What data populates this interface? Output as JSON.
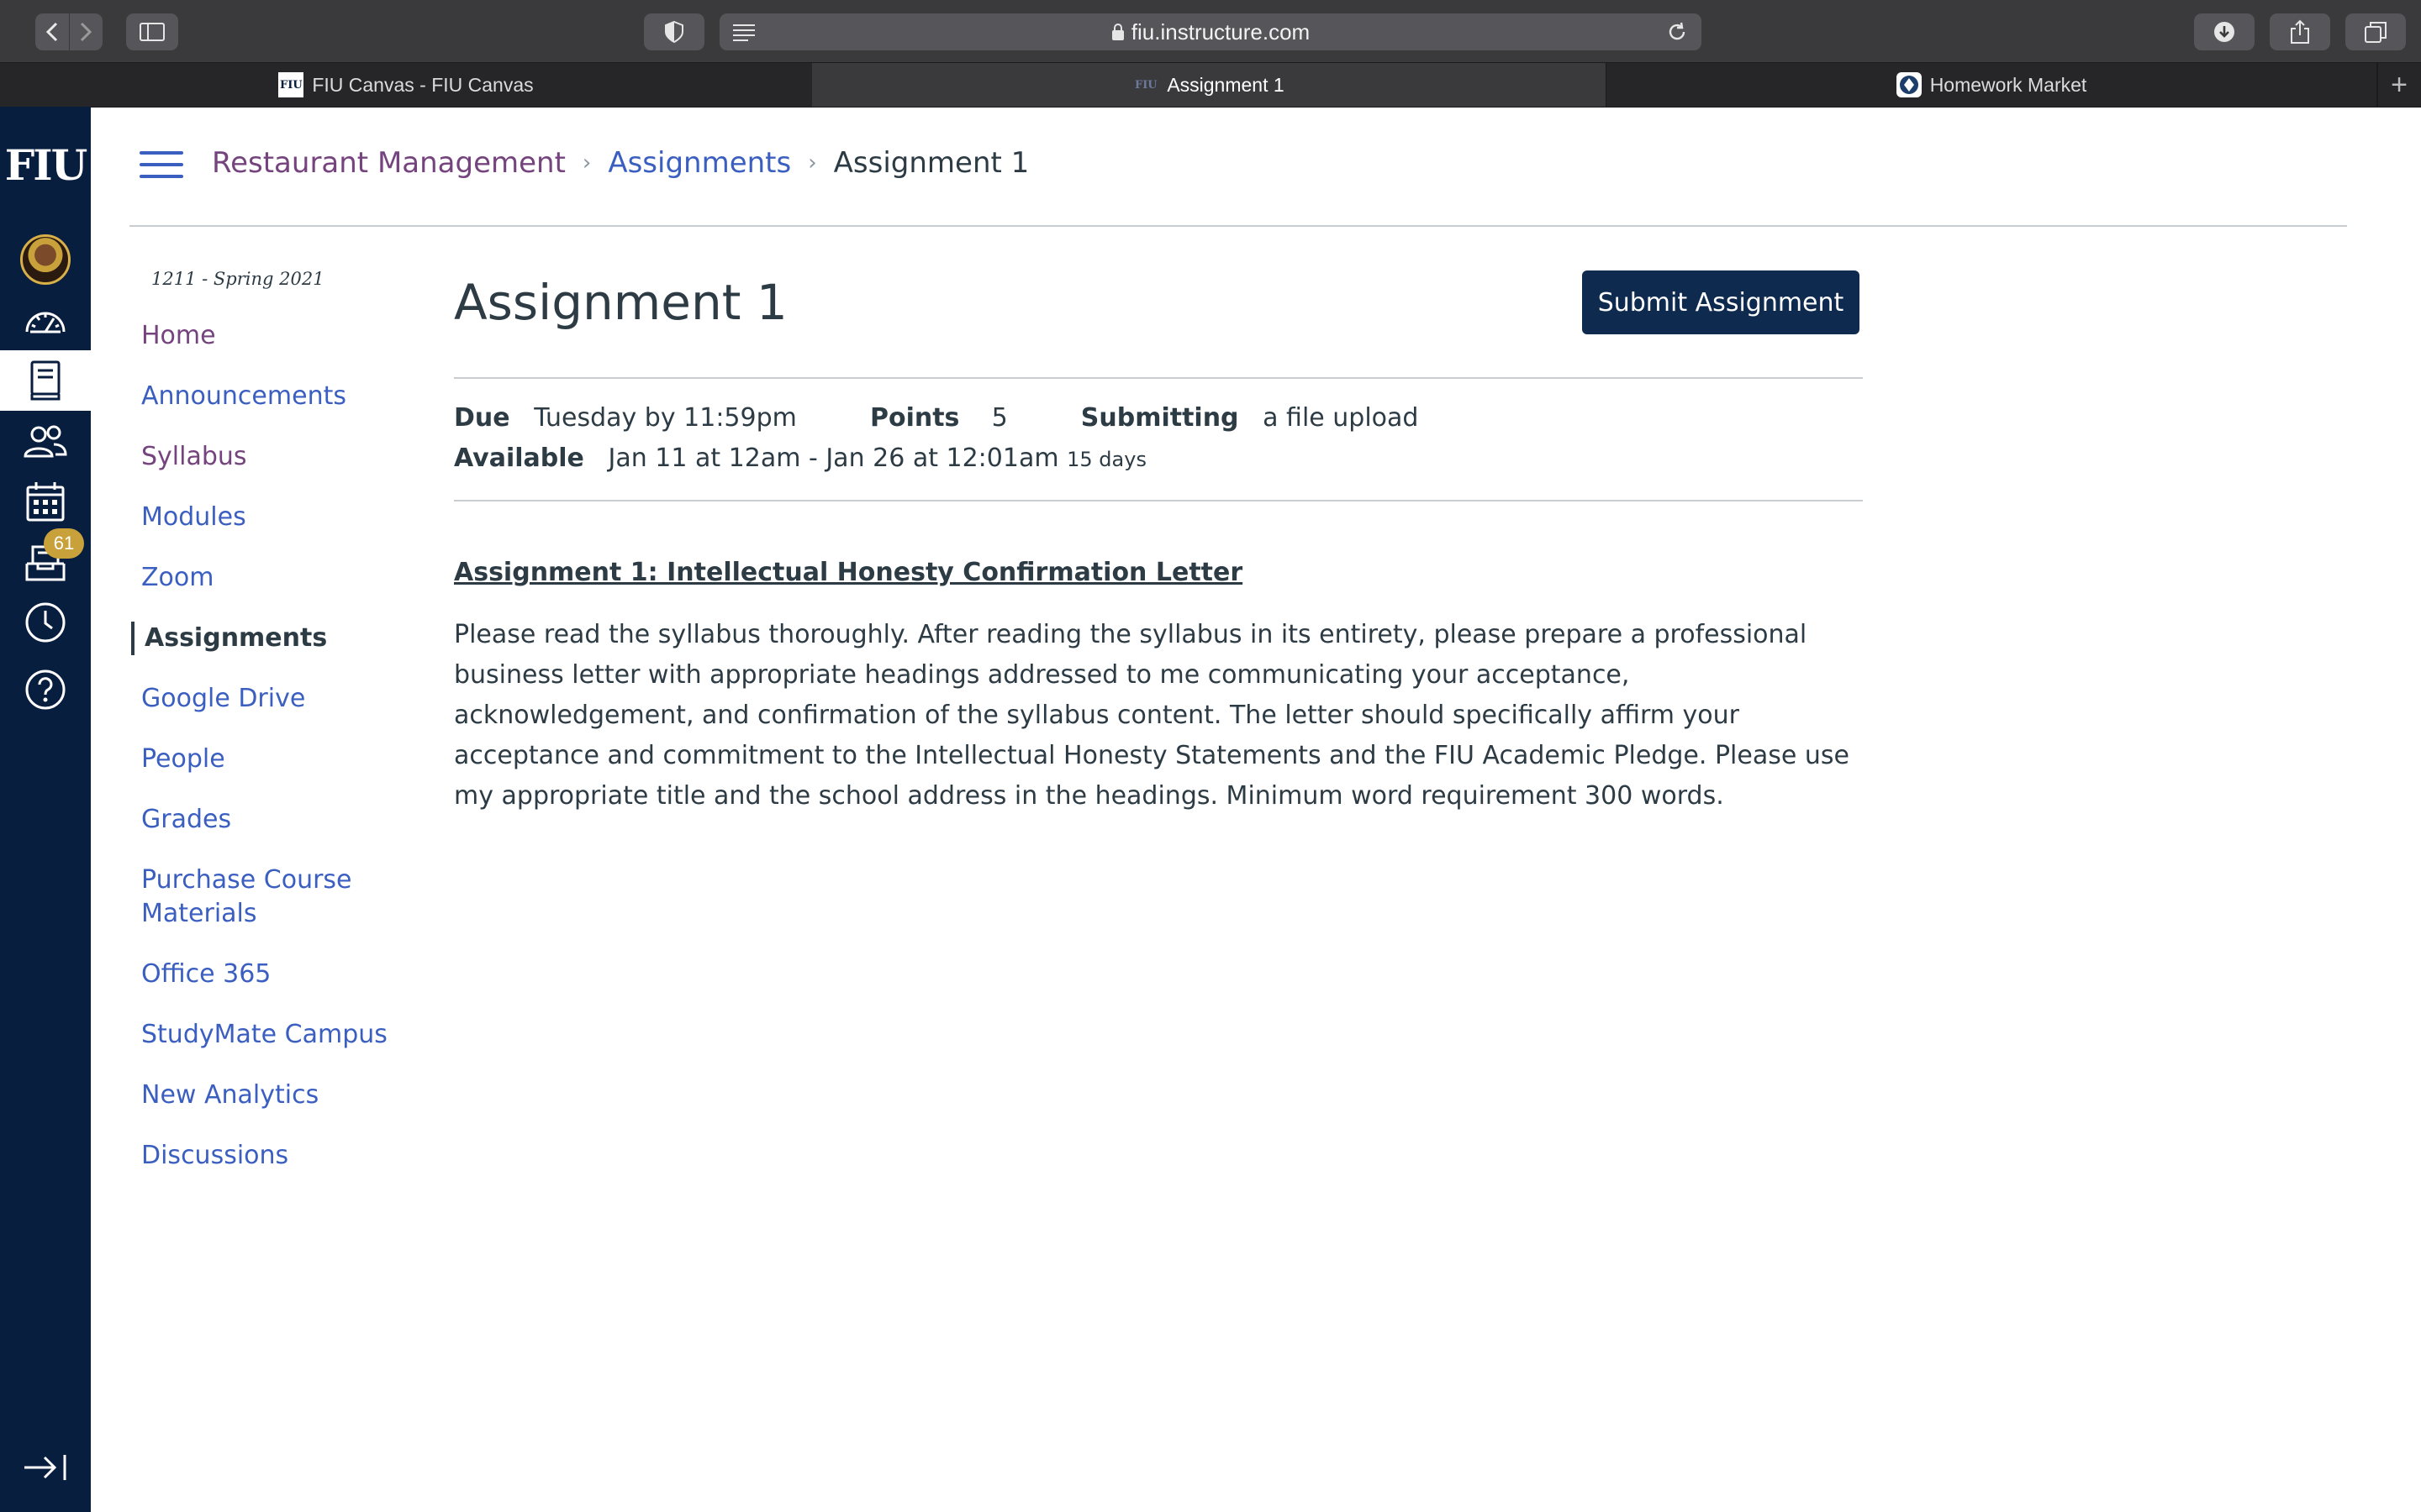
{
  "browser": {
    "url": "fiu.instructure.com",
    "tabs": [
      {
        "label": "FIU Canvas - FIU Canvas",
        "favicon": "FIU"
      },
      {
        "label": "Assignment 1",
        "favicon": "FIU"
      },
      {
        "label": "Homework Market",
        "favicon": "homework-market-logo"
      }
    ]
  },
  "global_nav": {
    "logo": "FIU",
    "inbox_badge": "61"
  },
  "breadcrumb": {
    "course": "Restaurant Management",
    "section": "Assignments",
    "page": "Assignment 1"
  },
  "course_nav": {
    "term": "1211 - Spring 2021",
    "items": [
      {
        "label": "Home"
      },
      {
        "label": "Announcements"
      },
      {
        "label": "Syllabus"
      },
      {
        "label": "Modules"
      },
      {
        "label": "Zoom"
      },
      {
        "label": "Assignments"
      },
      {
        "label": "Google Drive"
      },
      {
        "label": "People"
      },
      {
        "label": "Grades"
      },
      {
        "label": "Purchase Course Materials"
      },
      {
        "label": "Office 365"
      },
      {
        "label": "StudyMate Campus"
      },
      {
        "label": "New Analytics"
      },
      {
        "label": "Discussions"
      }
    ]
  },
  "assignment": {
    "title": "Assignment 1",
    "submit_label": "Submit Assignment",
    "due_label": "Due",
    "due_value": "Tuesday by 11:59pm",
    "points_label": "Points",
    "points_value": "5",
    "submitting_label": "Submitting",
    "submitting_value": "a file upload",
    "available_label": "Available",
    "available_value": "Jan 11 at 12am - Jan 26 at 12:01am",
    "available_days": "15 days",
    "heading": "Assignment 1: Intellectual Honesty Confirmation Letter",
    "body": "Please read the syllabus thoroughly. After reading the syllabus in its entirety, please prepare a professional business letter with appropriate headings addressed to me communicating your acceptance, acknowledgement, and confirmation of the syllabus content. The letter should specifically affirm your acceptance and commitment to the Intellectual Honesty Statements and the FIU Academic Pledge. Please use my appropriate title and the school address in the headings. Minimum word requirement 300 words."
  },
  "colors": {
    "nav_bg": "#081e3f",
    "link": "#3b5fc0",
    "visited_link": "#75437d",
    "text": "#2d3b45",
    "button": "#0e2a4e",
    "badge": "#c9a13a"
  }
}
